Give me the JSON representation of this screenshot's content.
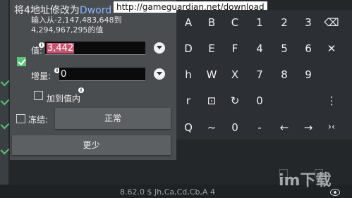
{
  "url_banner": "http://gameguardian.net/download",
  "dialog": {
    "title_prefix": "将4地址修改为",
    "title_type": "Dword",
    "range_text": "输入从-2,147,483,648到4,294,967,295的值",
    "value_label": "值:",
    "value_text": "3,442",
    "increment_label": "增量:",
    "increment_text": "0",
    "add_to_value_label": "加到值内",
    "freeze_label": "冻结:",
    "freeze_mode": "正常",
    "less_button": "更少"
  },
  "keyboard": {
    "rows": [
      [
        "A",
        "B",
        "C",
        "1",
        "2",
        "3",
        "⌫"
      ],
      [
        "D",
        "E",
        "F",
        "4",
        "5",
        "6",
        "✕"
      ],
      [
        "h",
        "W",
        "X",
        "7",
        "8",
        "9",
        ""
      ],
      [
        "r",
        "⊡",
        "↻",
        "0",
        "",
        "",
        "⋮"
      ],
      [
        "Q",
        "~",
        "0",
        "-",
        "←",
        "→",
        "›‹"
      ]
    ]
  },
  "footer": {
    "version_text": "8.62.0 $ Jh,Ca,Cd,Cb,A 4",
    "watermark": "im下载"
  }
}
